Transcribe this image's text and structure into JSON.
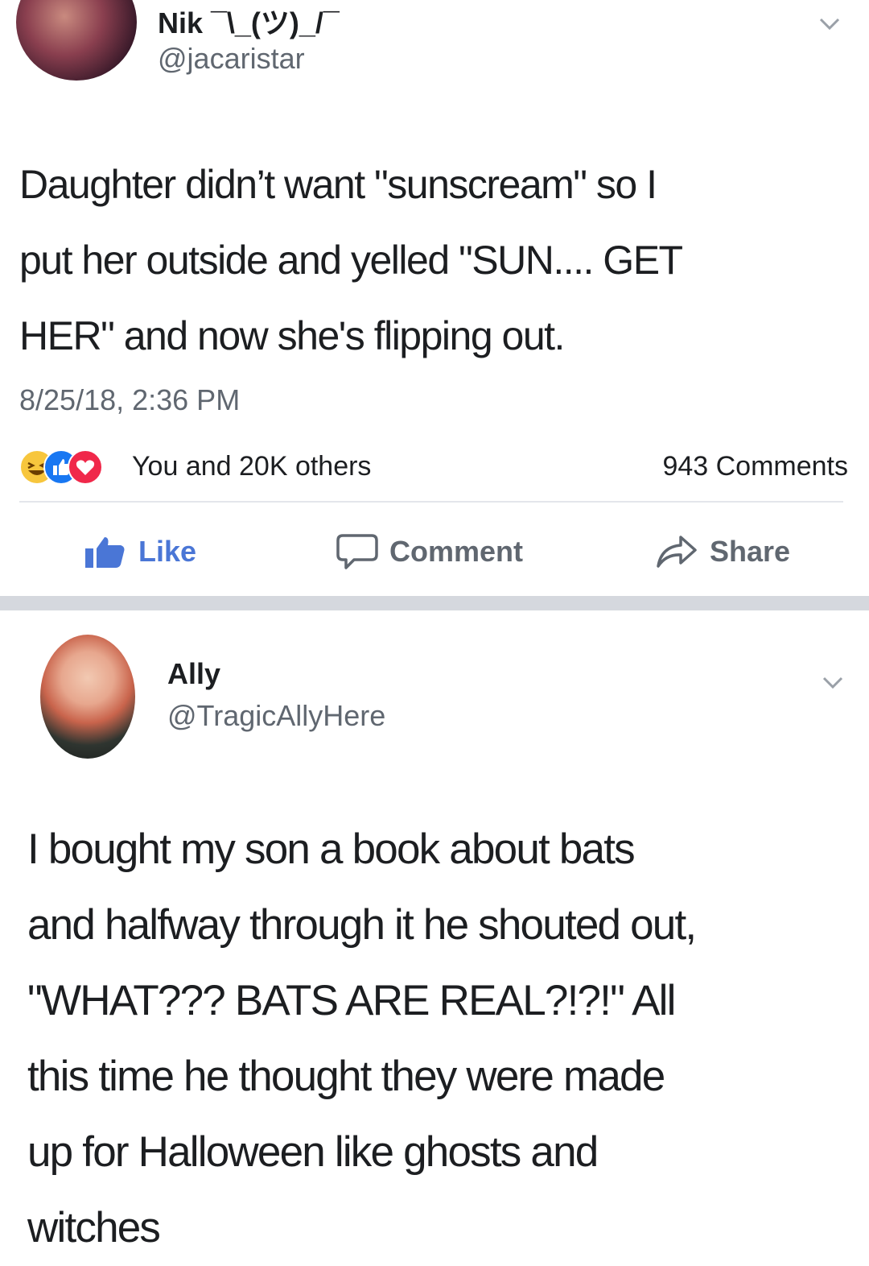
{
  "posts": [
    {
      "name": "Nik ¯\\_(ツ)_/¯",
      "handle": "@jacaristar",
      "text_lines": [
        "Daughter didn’t want \"sunscream\" so I",
        "put her outside and yelled \"SUN.... GET",
        "HER\" and now she's flipping out."
      ],
      "timestamp": "8/25/18, 2:36 PM",
      "reactions_text": "You and 20K others",
      "comments_text": "943 Comments",
      "actions": {
        "like": "Like",
        "comment": "Comment",
        "share": "Share"
      }
    },
    {
      "name": "Ally",
      "handle": "@TragicAllyHere",
      "text_lines": [
        "I bought my son a book about bats",
        "and halfway through it he shouted out,",
        "\"WHAT??? BATS ARE REAL?!?!\" All",
        "this time he thought they were made",
        "up for Halloween like ghosts and",
        "witches"
      ]
    }
  ],
  "colors": {
    "like_blue": "#4a76d6",
    "text_dark": "#1c1e21",
    "text_gray": "#606770",
    "separator": "#d5d8de"
  },
  "icons": [
    "chevron-down-icon",
    "haha-reaction-icon",
    "like-reaction-icon",
    "love-reaction-icon",
    "thumbs-up-icon",
    "comment-bubble-icon",
    "share-arrow-icon"
  ]
}
